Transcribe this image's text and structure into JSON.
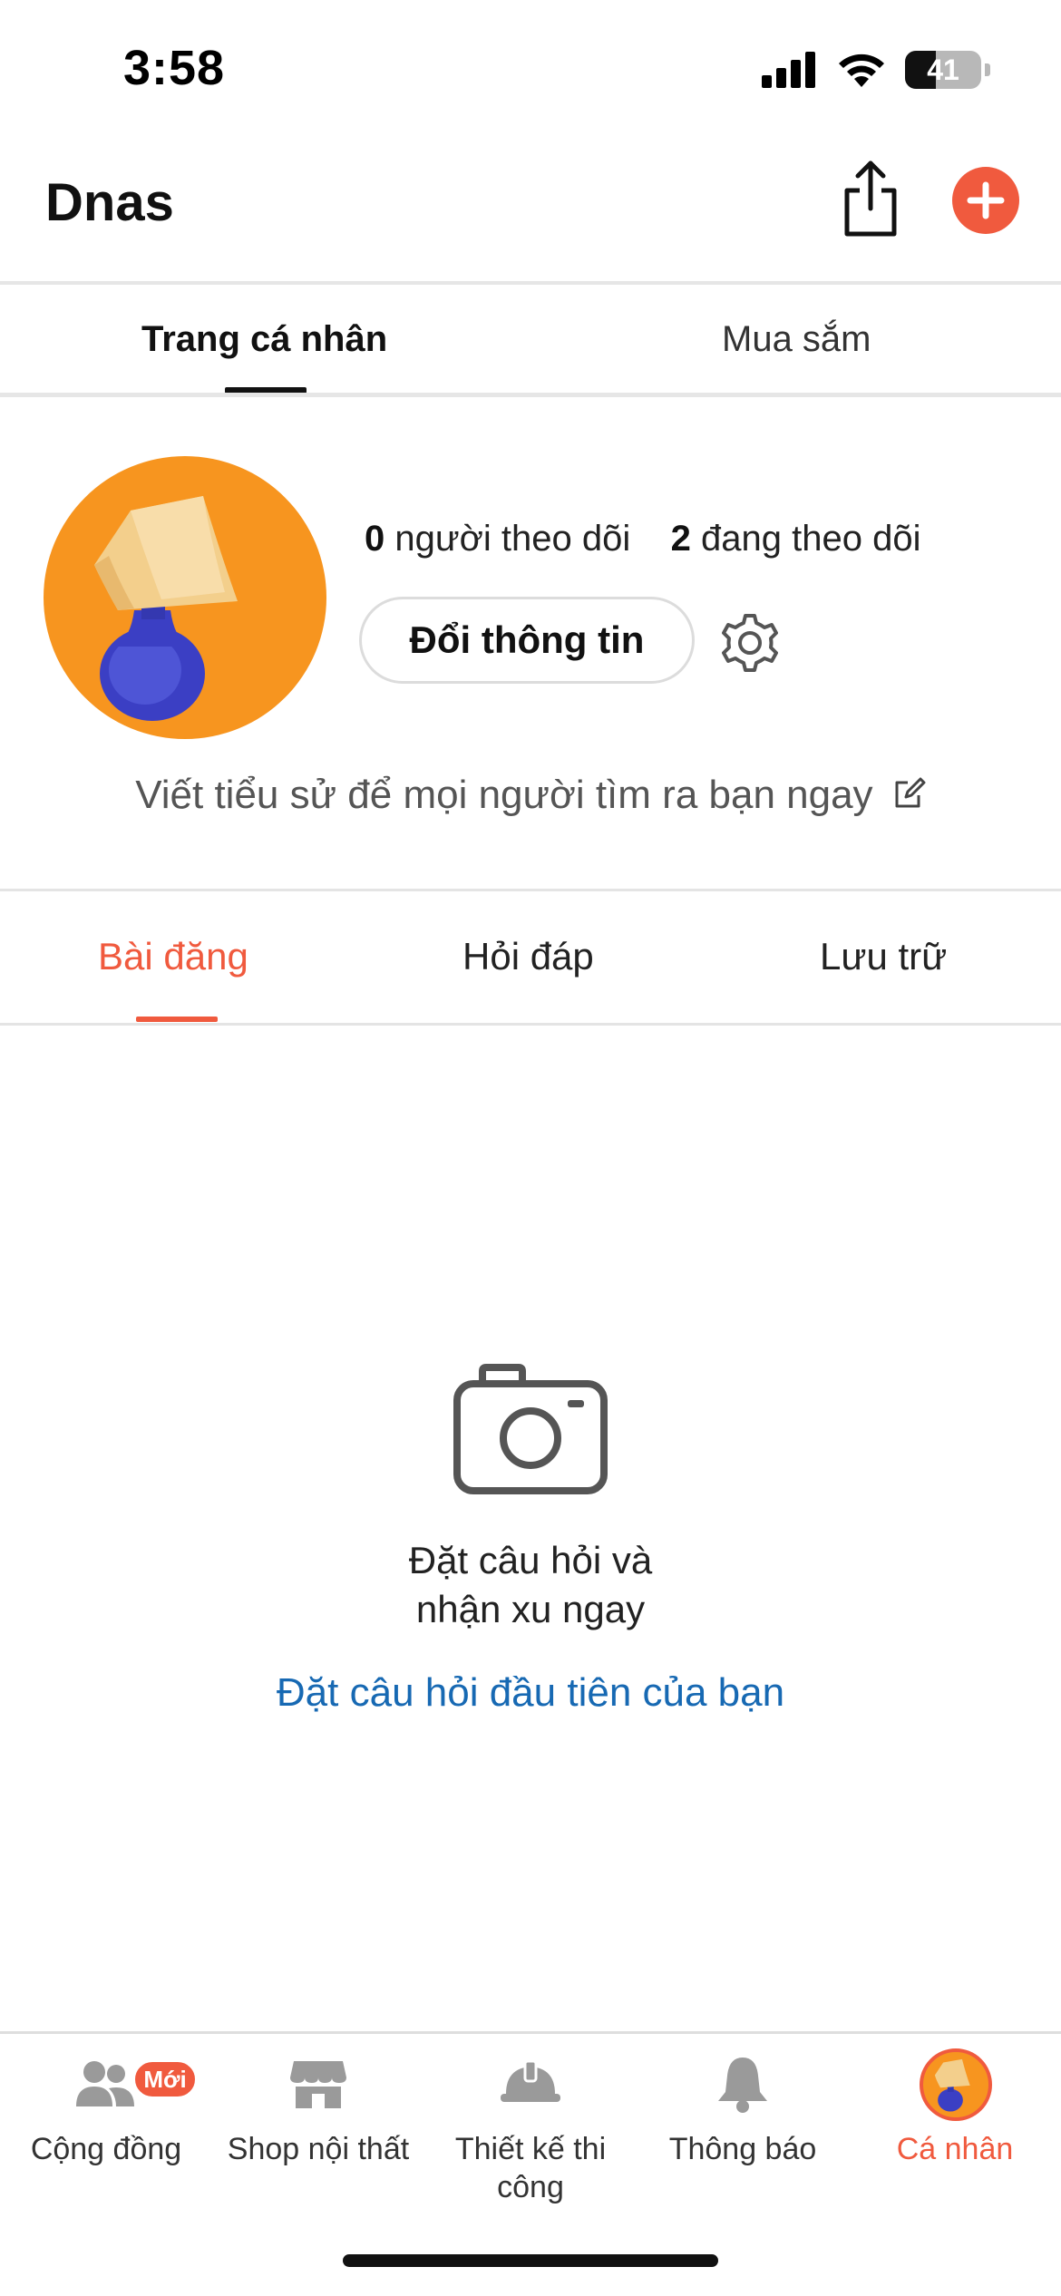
{
  "status_bar": {
    "time": "3:58",
    "battery": "41"
  },
  "header": {
    "title": "Dnas"
  },
  "top_tabs": [
    {
      "label": "Trang cá nhân",
      "active": true
    },
    {
      "label": "Mua sắm",
      "active": false
    }
  ],
  "profile": {
    "followers_count": "0",
    "followers_label": "người theo dõi",
    "following_count": "2",
    "following_label": "đang theo dõi",
    "edit_button": "Đổi thông tin",
    "bio_prompt": "Viết tiểu sử để mọi người tìm ra bạn ngay"
  },
  "content_tabs": [
    {
      "label": "Bài đăng",
      "active": true
    },
    {
      "label": "Hỏi đáp",
      "active": false
    },
    {
      "label": "Lưu trữ",
      "active": false
    }
  ],
  "empty_state": {
    "line1": "Đặt câu hỏi và",
    "line2": "nhận xu ngay",
    "link": "Đặt câu hỏi đầu tiên của bạn"
  },
  "bottom_nav": [
    {
      "label": "Cộng đồng",
      "icon": "people-icon",
      "badge": "Mới",
      "active": false
    },
    {
      "label": "Shop nội thất",
      "icon": "store-icon",
      "active": false
    },
    {
      "label_line1": "Thiết kế thi",
      "label_line2": "công",
      "icon": "hard-hat-icon",
      "active": false
    },
    {
      "label": "Thông báo",
      "icon": "bell-icon",
      "active": false
    },
    {
      "label": "Cá nhân",
      "icon": "avatar-icon",
      "active": true
    }
  ],
  "colors": {
    "accent": "#f05a3e",
    "link": "#1769b3",
    "avatar_bg": "#f7951f"
  }
}
